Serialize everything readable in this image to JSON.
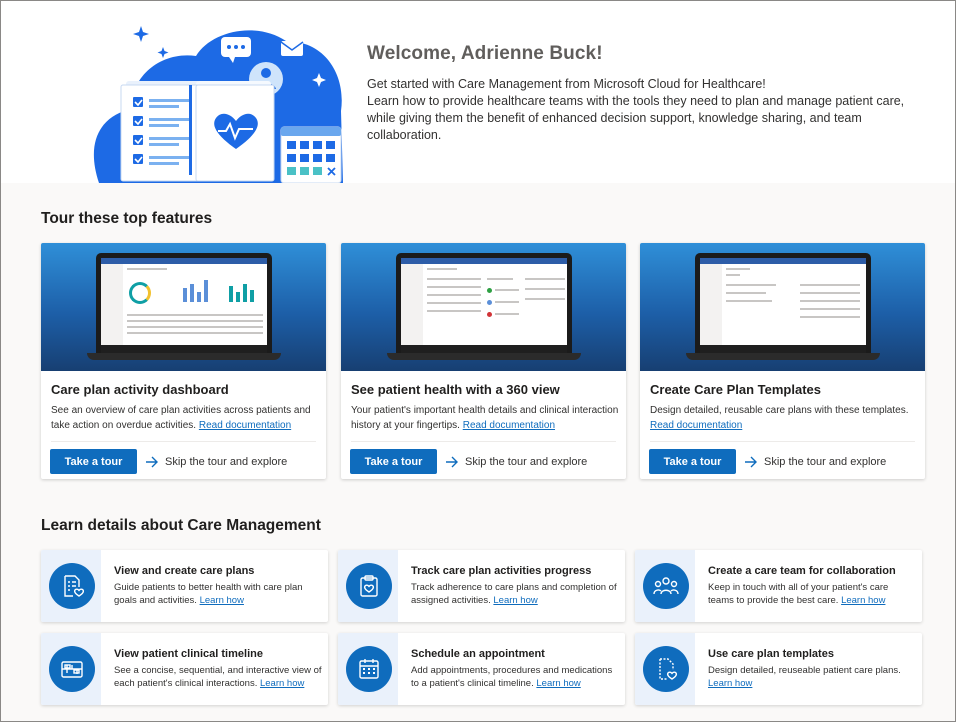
{
  "welcome": {
    "title": "Welcome, Adrienne Buck!",
    "subtitle": "Get started with Care Management from Microsoft Cloud for Healthcare!",
    "description": "Learn how to provide healthcare teams with the tools they need to plan and manage patient care, while giving them the benefit of enhanced decision support, knowledge sharing, and team collaboration."
  },
  "tour": {
    "heading": "Tour these top features",
    "cards": [
      {
        "title": "Care plan activity dashboard",
        "description": "See an overview of care plan activities across patients and take action on overdue activities.",
        "link": "Read documentation",
        "button": "Take a tour",
        "skip": "Skip the tour and explore"
      },
      {
        "title": "See patient health with a 360 view",
        "description": "Your patient's important health details and clinical interaction history at your fingertips.",
        "link": "Read documentation",
        "button": "Take a tour",
        "skip": "Skip the tour and explore"
      },
      {
        "title": "Create Care Plan Templates",
        "description": "Design detailed, reusable care plans with these templates.",
        "link": "Read documentation",
        "button": "Take a tour",
        "skip": "Skip the tour and explore"
      }
    ]
  },
  "learn": {
    "heading": "Learn details about Care Management",
    "tiles": [
      {
        "title": "View and create care plans",
        "description": "Guide patients to better health with care plan goals and activities.",
        "link": "Learn how",
        "icon": "care-plan-icon"
      },
      {
        "title": "Track care plan activities progress",
        "description": "Track adherence to care plans and completion of assigned activities.",
        "link": "Learn how",
        "icon": "clipboard-heart-icon"
      },
      {
        "title": "Create a care team for collaboration",
        "description": "Keep in touch with all of your patient's care teams to provide the best care.",
        "link": "Learn how",
        "icon": "people-team-icon"
      },
      {
        "title": "View patient clinical timeline",
        "description": "See a concise, sequential, and interactive view of each patient's clinical interactions.",
        "link": "Learn how",
        "icon": "timeline-icon"
      },
      {
        "title": "Schedule an appointment",
        "description": "Add appointments, procedures and medications to a patient's clinical timeline.",
        "link": "Learn how",
        "icon": "calendar-icon"
      },
      {
        "title": "Use care plan templates",
        "description": "Design detailed, reuseable patient care plans.",
        "link": "Learn how",
        "icon": "template-heart-icon"
      }
    ]
  },
  "colors": {
    "accent": "#0f6cbd",
    "tile_side": "#eaf1fb",
    "hero_blob": "#1d6ae5"
  }
}
